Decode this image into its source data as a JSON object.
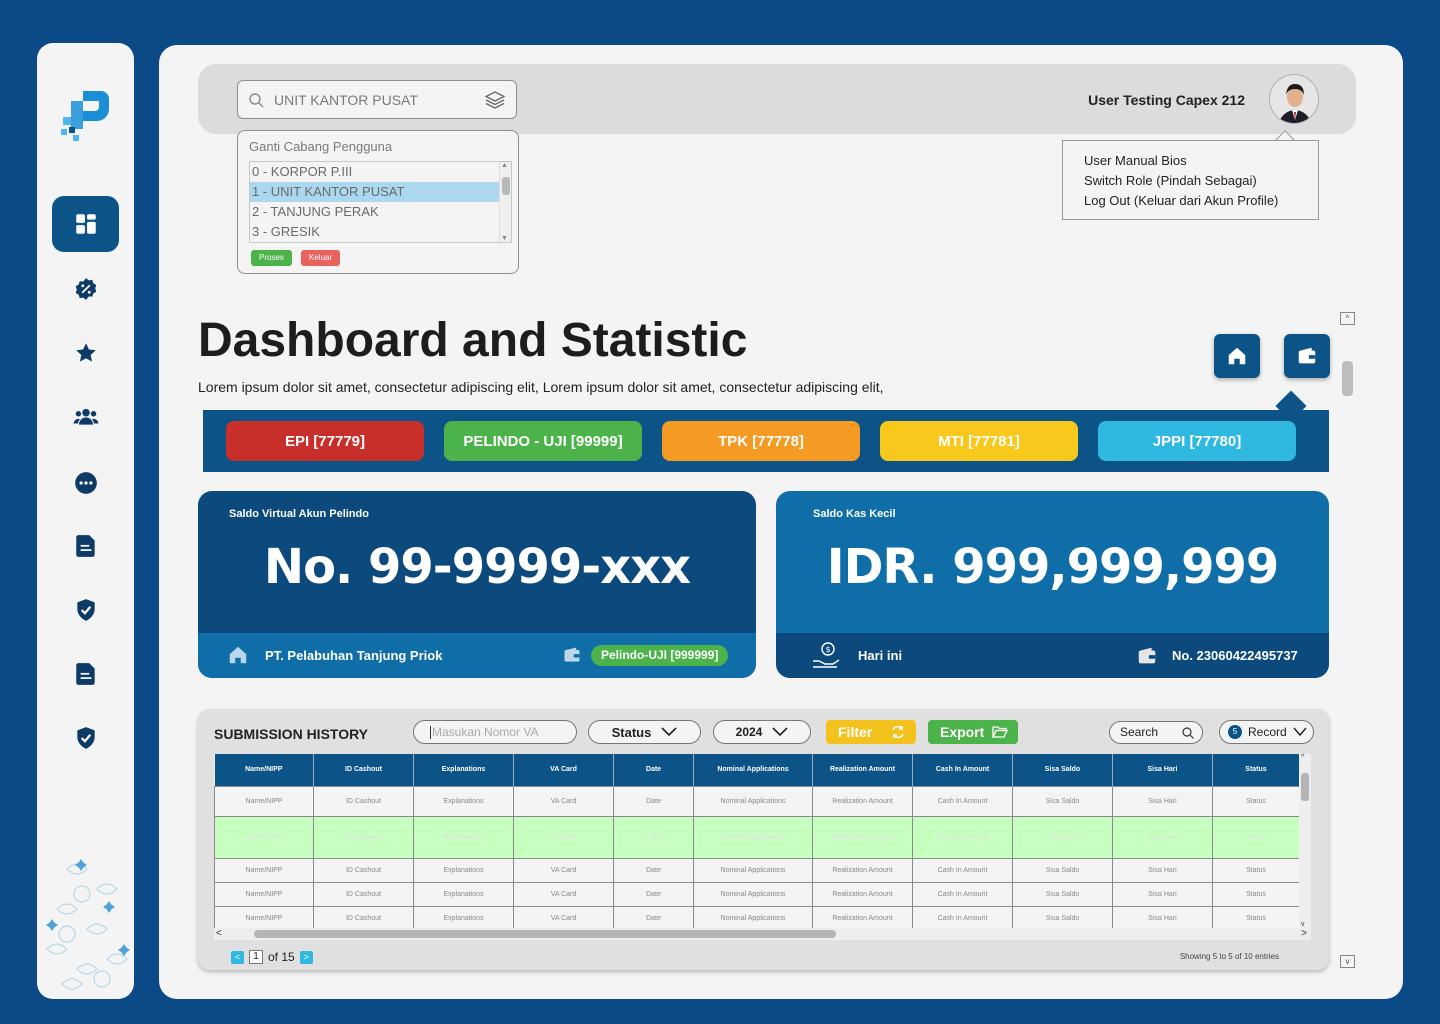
{
  "sidebar": {
    "items": [
      {
        "name": "dashboard-icon",
        "active": true
      },
      {
        "name": "discount-badge-icon",
        "active": false
      },
      {
        "name": "star-icon",
        "active": false
      },
      {
        "name": "users-icon",
        "active": false
      },
      {
        "name": "more-icon",
        "active": false
      },
      {
        "name": "document-icon",
        "active": false
      },
      {
        "name": "shield-check-icon",
        "active": false
      },
      {
        "name": "document-icon",
        "active": false
      },
      {
        "name": "shield-check-icon",
        "active": false
      }
    ]
  },
  "topbar": {
    "branch_value": "UNIT KANTOR PUSAT",
    "user_name": "User Testing Capex 212"
  },
  "branch_popup": {
    "title": "Ganti Cabang Pengguna",
    "options": [
      "0 - KORPOR P.III",
      "1 - UNIT KANTOR PUSAT",
      "2 - TANJUNG PERAK",
      "3 - GRESIK"
    ],
    "selected_index": 1,
    "process_label": "Proses",
    "exit_label": "Keluar"
  },
  "user_menu": {
    "items": [
      "User Manual Bios",
      "Switch Role (Pindah Sebagai)",
      "Log Out (Keluar dari Akun Profile)"
    ]
  },
  "page": {
    "title": "Dashboard and Statistic",
    "description": "Lorem ipsum dolor sit amet, consectetur adipiscing elit, Lorem ipsum dolor sit amet, consectetur adipiscing elit,"
  },
  "entities": [
    {
      "label": "EPI [77779]",
      "color": "#c92f2a"
    },
    {
      "label": "PELINDO - UJI [99999]",
      "color": "#4cb34a"
    },
    {
      "label": "TPK [77778]",
      "color": "#f59a23"
    },
    {
      "label": "MTI [77781]",
      "color": "#f8c81c"
    },
    {
      "label": "JPPI [77780]",
      "color": "#2fb8e0"
    }
  ],
  "cards": {
    "virtual": {
      "label": "Saldo Virtual Akun Pelindo",
      "value": "No. 99-9999-xxx",
      "company": "PT. Pelabuhan Tanjung Priok",
      "badge": "Pelindo-UJI [999999]"
    },
    "petty": {
      "label": "Saldo Kas Kecil",
      "value": "IDR. 999,999,999",
      "period": "Hari ini",
      "account": "No. 23060422495737"
    }
  },
  "history": {
    "title": "SUBMISSION HISTORY",
    "va_placeholder": "Masukan Nomor VA",
    "status_label": "Status",
    "year_label": "2024",
    "filter_label": "Filter",
    "export_label": "Export",
    "search_label": "Search",
    "record_count": "5",
    "record_label": "Record",
    "columns": [
      "Name/NIPP",
      "ID Cashout",
      "Explanations",
      "VA Card",
      "Date",
      "Nominal Applications",
      "Realization Amount",
      "Cash In Amount",
      "Sisa Saldo",
      "Sisa Hari",
      "Status"
    ],
    "rows": [
      [
        "Name/NIPP",
        "ID Cashout",
        "Explanations",
        "VA Card",
        "Date",
        "Nominal Applications",
        "Realization Amount",
        "Cash In Amount",
        "Sisa Saldo",
        "Sisa Hari",
        "Status"
      ],
      [
        "Name/NIPP",
        "ID Cashout",
        "Explanations",
        "VA Card",
        "Date",
        "Nominal Applications",
        "Realization Amount",
        "Cash In Amount",
        "Sisa Saldo",
        "Sisa Hari",
        "Status"
      ],
      [
        "Name/NIPP",
        "ID Cashout",
        "Explanations",
        "VA Card",
        "Date",
        "Nominal Applications",
        "Realization Amount",
        "Cash In Amount",
        "Sisa Saldo",
        "Sisa Hari",
        "Status"
      ],
      [
        "Name/NIPP",
        "ID Cashout",
        "Explanations",
        "VA Card",
        "Date",
        "Nominal Applications",
        "Realization Amount",
        "Cash In Amount",
        "Sisa Saldo",
        "Sisa Hari",
        "Status"
      ],
      [
        "Name/NIPP",
        "ID Cashout",
        "Explanations",
        "VA Card",
        "Date",
        "Nominal Applications",
        "Realization Amount",
        "Cash In Amount",
        "Sisa Saldo",
        "Sisa Hari",
        "Status"
      ]
    ],
    "highlight_row": 1,
    "page_current": "1",
    "page_total_text": "of 15",
    "entries_text": "Showing 5 to 5 of 10 entries"
  },
  "colors": {
    "primary": "#0c5488",
    "primary_dark": "#0c4a87",
    "card_virtual": "#0c4a7e",
    "card_petty": "#0f6ea8"
  }
}
